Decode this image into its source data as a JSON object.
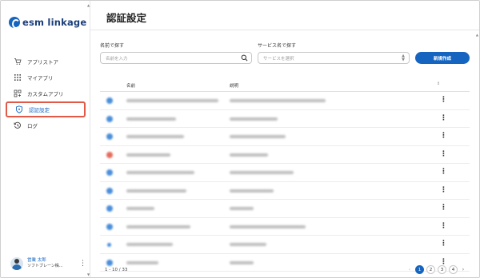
{
  "app": {
    "logo_text": "esm linkage"
  },
  "sidebar": {
    "items": [
      {
        "label": "アプリストア",
        "icon": "cart-icon"
      },
      {
        "label": "マイアプリ",
        "icon": "grid-icon"
      },
      {
        "label": "カスタムアプリ",
        "icon": "custom-app-icon"
      },
      {
        "label": "認証設定",
        "icon": "shield-icon",
        "active": true
      },
      {
        "label": "ログ",
        "icon": "history-icon"
      }
    ],
    "user": {
      "name": "営業 太郎",
      "org": "ソフトブレーン株..."
    }
  },
  "main": {
    "title": "認証設定",
    "filter_name": {
      "label": "名前で探す",
      "placeholder": "名前を入力"
    },
    "filter_service": {
      "label": "サービス名で探す",
      "placeholder": "サービスを選択"
    },
    "new_button": "新規作成",
    "table": {
      "columns": [
        "名前",
        "説明"
      ]
    },
    "pagination": {
      "range": "1 - 10 / 33",
      "pages": [
        "1",
        "2",
        "3",
        "4"
      ],
      "current": "1"
    }
  },
  "colors": {
    "accent": "#1565c0",
    "highlight": "#e05a47"
  }
}
